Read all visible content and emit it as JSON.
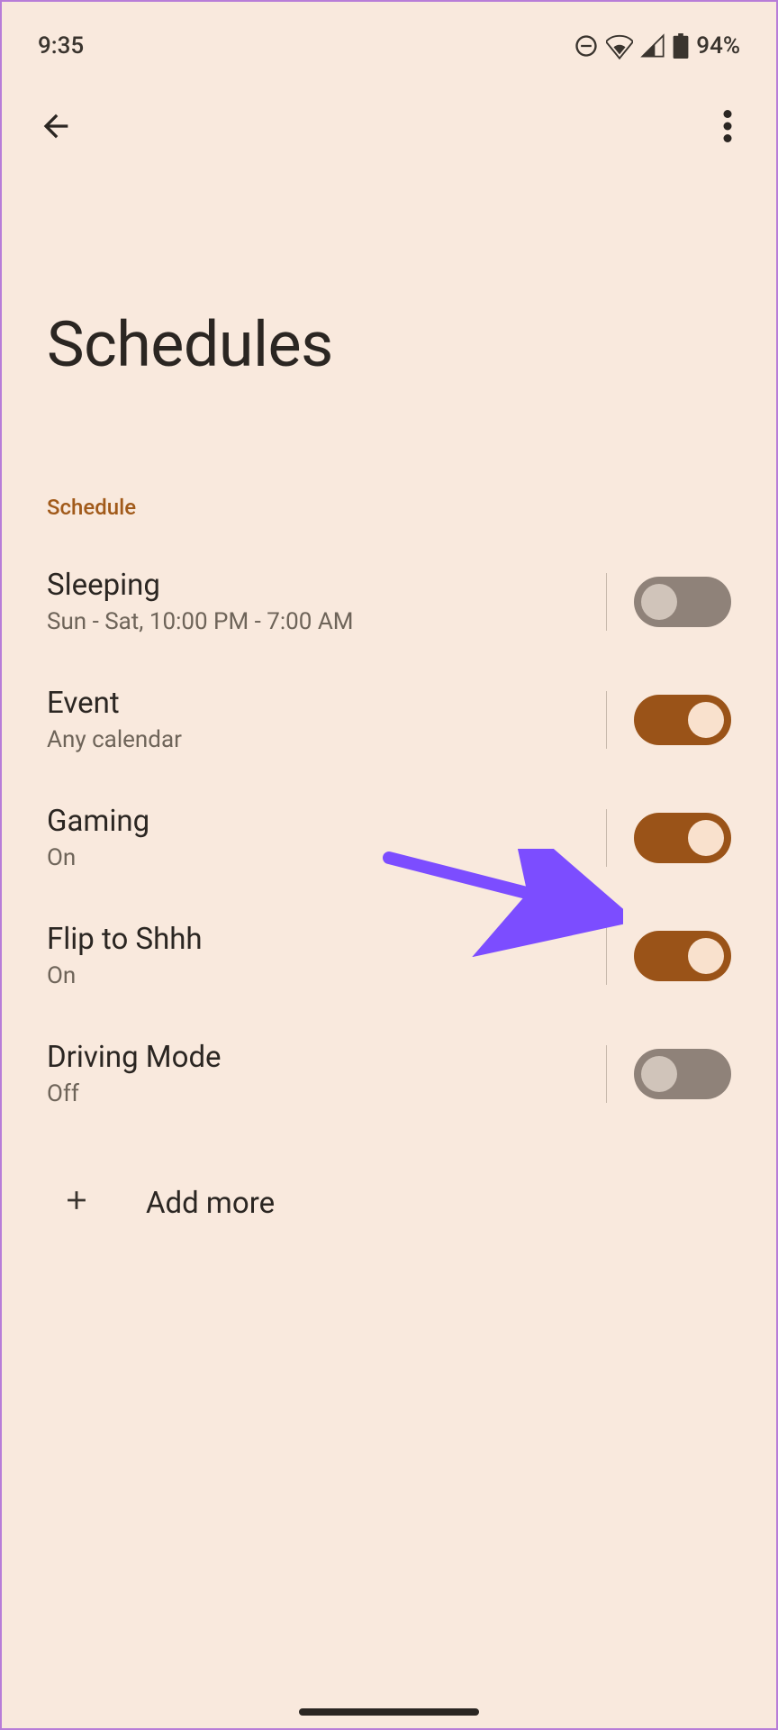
{
  "status_bar": {
    "time": "9:35",
    "battery_pct": "94%"
  },
  "page": {
    "title": "Schedules"
  },
  "section_header": "Schedule",
  "schedules": [
    {
      "title": "Sleeping",
      "subtitle": "Sun - Sat, 10:00 PM - 7:00 AM",
      "on": false
    },
    {
      "title": "Event",
      "subtitle": "Any calendar",
      "on": true
    },
    {
      "title": "Gaming",
      "subtitle": "On",
      "on": true
    },
    {
      "title": "Flip to Shhh",
      "subtitle": "On",
      "on": true
    },
    {
      "title": "Driving Mode",
      "subtitle": "Off",
      "on": false
    }
  ],
  "add_more_label": "Add more"
}
